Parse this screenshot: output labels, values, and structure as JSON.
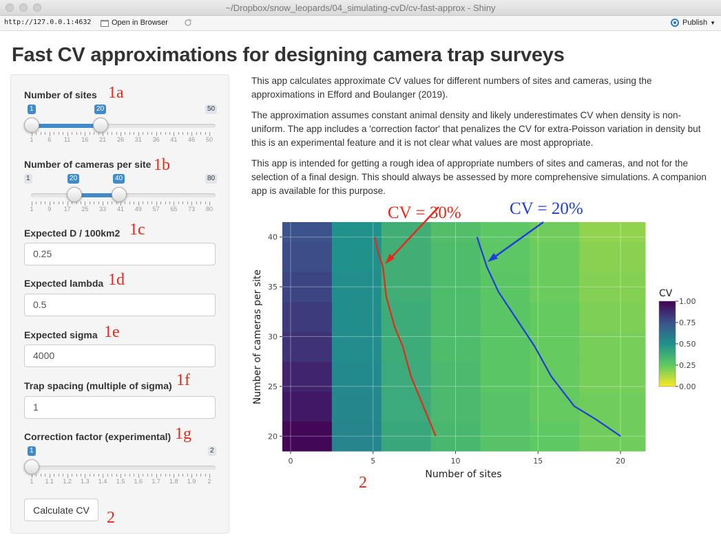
{
  "window": {
    "title": "~/Dropbox/snow_leopards/04_simulating-cvD/cv-fast-approx - Shiny"
  },
  "toolbar": {
    "url": "http://127.0.0.1:4632",
    "open_label": "Open in Browser",
    "publish_label": "Publish"
  },
  "page": {
    "title": "Fast CV approximations for designing camera trap surveys"
  },
  "sidebar": {
    "sites": {
      "label": "Number of sites",
      "min": "1",
      "max": "50",
      "from": "1",
      "to": "20",
      "ticks": [
        "1",
        "6",
        "11",
        "16",
        "21",
        "26",
        "31",
        "36",
        "41",
        "46",
        "50"
      ]
    },
    "cameras": {
      "label": "Number of cameras per site",
      "min": "1",
      "max": "80",
      "from": "20",
      "to": "40",
      "ticks": [
        "1",
        "9",
        "17",
        "25",
        "33",
        "41",
        "49",
        "57",
        "65",
        "73",
        "80"
      ]
    },
    "density": {
      "label": "Expected D / 100km2",
      "value": "0.25"
    },
    "lambda": {
      "label": "Expected lambda",
      "value": "0.5"
    },
    "sigma": {
      "label": "Expected sigma",
      "value": "4000"
    },
    "spacing": {
      "label": "Trap spacing (multiple of sigma)",
      "value": "1"
    },
    "correction": {
      "label": "Correction factor (experimental)",
      "min": "1",
      "max": "2",
      "from": "1",
      "ticks": [
        "1",
        "1.1",
        "1.2",
        "1.3",
        "1.4",
        "1.5",
        "1.6",
        "1.7",
        "1.8",
        "1.9",
        "2"
      ]
    },
    "button_label": "Calculate CV"
  },
  "annotations": {
    "a1": "1a",
    "b1": "1b",
    "c1": "1c",
    "d1": "1d",
    "e1": "1e",
    "f1": "1f",
    "g1": "1g",
    "btn2": "2",
    "plot2": "2",
    "cv30": "CV = 30%",
    "cv20": "CV = 20%"
  },
  "intro": {
    "p1": "This app calculates approximate CV values for different numbers of sites and cameras, using the approximations in Efford and Boulanger (2019).",
    "p2": "The approximation assumes constant animal density and likely underestimates CV when density is non-uniform. The app includes a 'correction factor' that penalizes the CV for extra-Poisson variation in density but this is an experimental feature and it is not clear what values are most appropriate.",
    "p3": "This app is intended for getting a rough idea of appropriate numbers of sites and cameras, and not for the selection of a final design. This should always be assessed by more comprehensive simulations. A companion app is available for this purpose."
  },
  "colors": {
    "accent": "#428bca",
    "annotation_red": "#e8281a",
    "annotation_blue": "#1f3ddf"
  },
  "chart_data": {
    "type": "heatmap",
    "xlabel": "Number of sites",
    "ylabel": "Number of cameras per site",
    "x_ticks": [
      "0",
      "5",
      "10",
      "15",
      "20"
    ],
    "y_ticks": [
      "20",
      "25",
      "30",
      "35",
      "40"
    ],
    "xlim": [
      -0.5,
      21.5
    ],
    "ylim": [
      18.5,
      41.5
    ],
    "grid": true,
    "x_cells": [
      1,
      4,
      7,
      10,
      13,
      16,
      19
    ],
    "y_cells": [
      20,
      23,
      26,
      29,
      32,
      35,
      38,
      41
    ],
    "cv": [
      [
        0.98,
        0.55,
        0.4,
        0.33,
        0.28,
        0.25,
        0.22
      ],
      [
        0.93,
        0.54,
        0.39,
        0.32,
        0.28,
        0.24,
        0.22
      ],
      [
        0.89,
        0.53,
        0.39,
        0.32,
        0.27,
        0.24,
        0.21
      ],
      [
        0.85,
        0.52,
        0.38,
        0.31,
        0.27,
        0.24,
        0.21
      ],
      [
        0.82,
        0.51,
        0.38,
        0.31,
        0.27,
        0.24,
        0.2
      ],
      [
        0.79,
        0.51,
        0.37,
        0.31,
        0.27,
        0.23,
        0.19
      ],
      [
        0.77,
        0.5,
        0.37,
        0.31,
        0.26,
        0.23,
        0.18
      ],
      [
        0.75,
        0.5,
        0.37,
        0.3,
        0.26,
        0.22,
        0.17
      ]
    ],
    "colorbar": {
      "title": "CV",
      "ticks": [
        "1.00",
        "0.75",
        "0.50",
        "0.25",
        "0.00"
      ],
      "range": [
        0,
        1
      ]
    },
    "contours": [
      {
        "level": "30%",
        "color": "#e8281a",
        "x": [
          8.8,
          7.3,
          6.8,
          6.3,
          5.8,
          5.6,
          5.3,
          5.1
        ],
        "y": [
          20,
          26,
          29,
          31,
          34,
          37,
          38.5,
          40
        ]
      },
      {
        "level": "20%",
        "color": "#1f3ddf",
        "x": [
          20.0,
          18.5,
          17.2,
          15.8,
          14.8,
          13.6,
          12.6,
          11.9,
          11.3
        ],
        "y": [
          20,
          21.7,
          23,
          26,
          29,
          32,
          34.5,
          37,
          40
        ]
      }
    ]
  }
}
